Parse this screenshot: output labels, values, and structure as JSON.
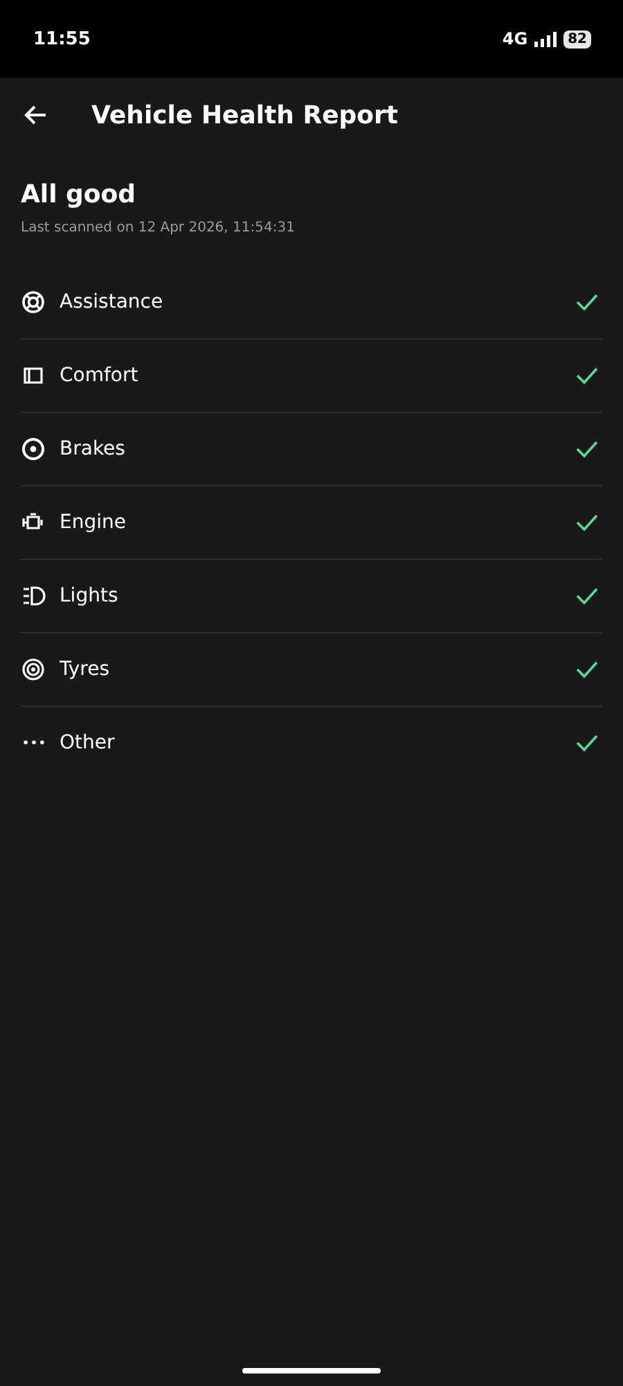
{
  "status_bar": {
    "time": "11:55",
    "network": "4G",
    "battery": "82"
  },
  "header": {
    "title": "Vehicle Health Report"
  },
  "summary": {
    "title": "All good",
    "subtitle": "Last scanned on 12 Apr 2026, 11:54:31"
  },
  "items": [
    {
      "label": "Assistance",
      "kind": "lifebuoy",
      "ok": true
    },
    {
      "label": "Comfort",
      "kind": "seat",
      "ok": true
    },
    {
      "label": "Brakes",
      "kind": "disc",
      "ok": true
    },
    {
      "label": "Engine",
      "kind": "engine",
      "ok": true
    },
    {
      "label": "Lights",
      "kind": "headlight",
      "ok": true
    },
    {
      "label": "Tyres",
      "kind": "tyre",
      "ok": true
    },
    {
      "label": "Other",
      "kind": "dots",
      "ok": true
    }
  ]
}
